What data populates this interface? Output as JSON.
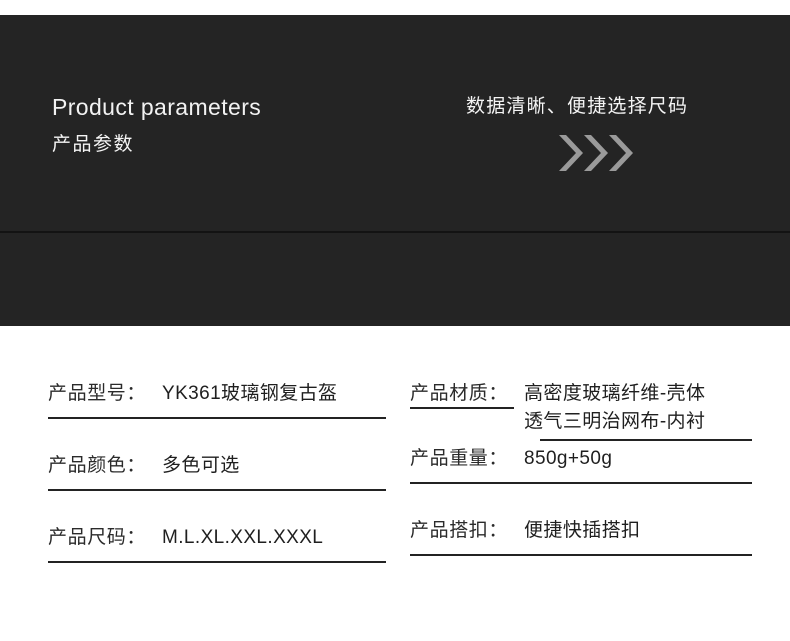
{
  "hero": {
    "title_en": "Product parameters",
    "title_cn": "产品参数",
    "tagline": "数据清晰、便捷选择尺码",
    "chevron_icon": "double-chevron-right-icon",
    "chevron_count": 3,
    "background_color": "#242424",
    "text_color": "#f4f4f4",
    "chevron_color": "#9a9a9a",
    "divider_color": "#131313"
  },
  "specs": {
    "left_column": [
      {
        "label": "产品型号：",
        "value_lines": [
          "YK361玻璃钢复古盔"
        ]
      },
      {
        "label": "产品颜色：",
        "value_lines": [
          "多色可选"
        ]
      },
      {
        "label": "产品尺码：",
        "value_lines": [
          "M.L.XL.XXL.XXXL"
        ]
      }
    ],
    "right_column": [
      {
        "label": "产品材质：",
        "value_lines": [
          "高密度玻璃纤维-壳体",
          "透气三明治网布-内衬"
        ]
      },
      {
        "label": "产品重量：",
        "value_lines": [
          "850g+50g"
        ]
      },
      {
        "label": "产品搭扣：",
        "value_lines": [
          "便捷快插搭扣"
        ]
      }
    ],
    "rule_color": "#232323",
    "text_color": "#1f1f1f"
  }
}
